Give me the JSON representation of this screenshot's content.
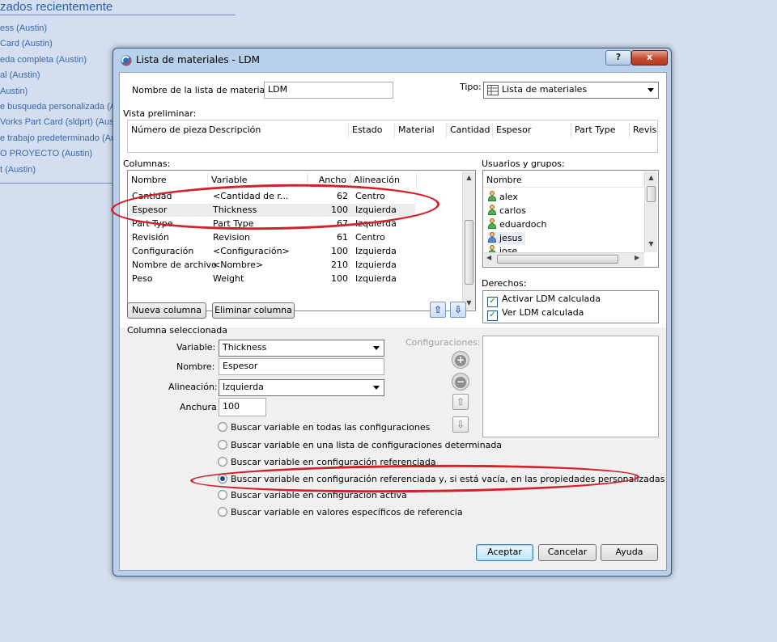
{
  "background": {
    "title": "zados recientemente",
    "items": [
      "ess (Austin)",
      "Card (Austin)",
      "eda completa (Austin)",
      "al (Austin)",
      "Austin)",
      "e busqueda personalizada (A",
      "Vorks Part Card  (sldprt) (Aus",
      "e trabajo predeterminado (Au",
      "O PROYECTO (Austin)",
      "t (Austin)"
    ]
  },
  "dialog": {
    "title": "Lista de materiales - LDM",
    "help_label": "?",
    "close_label": "x",
    "name_label": "Nombre de la lista de materiales:",
    "name_value": "LDM",
    "type_label": "Tipo:",
    "type_value": "Lista de materiales",
    "preview_label": "Vista preliminar:",
    "preview_columns": [
      "Número de pieza",
      "Descripción",
      "Estado",
      "Material",
      "Cantidad",
      "Espesor",
      "Part Type",
      "Revis"
    ],
    "columns_label": "Columnas:",
    "columns_headers": [
      "Nombre",
      "Variable",
      "Ancho",
      "Alineación"
    ],
    "columns_rows": [
      {
        "name": "Cantidad",
        "variable": "<Cantidad de r...",
        "width": "62",
        "align": "Centro"
      },
      {
        "name": "Espesor",
        "variable": "Thickness",
        "width": "100",
        "align": "Izquierda"
      },
      {
        "name": "Part Type",
        "variable": "Part Type",
        "width": "67",
        "align": "Izquierda"
      },
      {
        "name": "Revisión",
        "variable": "Revision",
        "width": "61",
        "align": "Centro"
      },
      {
        "name": "Configuración",
        "variable": "<Configuración>",
        "width": "100",
        "align": "Izquierda"
      },
      {
        "name": "Nombre de archivo",
        "variable": "<Nombre>",
        "width": "210",
        "align": "Izquierda"
      },
      {
        "name": "Peso",
        "variable": "Weight",
        "width": "100",
        "align": "Izquierda"
      }
    ],
    "users_label": "Usuarios y grupos:",
    "users_header": "Nombre",
    "users": [
      "alex",
      "carlos",
      "eduardoch",
      "jesus",
      "jose"
    ],
    "rights_label": "Derechos:",
    "rights": [
      "Activar LDM calculada",
      "Ver LDM calculada"
    ],
    "new_column": "Nueva columna",
    "delete_column": "Eliminar columna",
    "selected_column_label": "Columna seleccionada",
    "variable_label": "Variable:",
    "variable_value": "Thickness",
    "name_field_label": "Nombre:",
    "name_field_value": "Espesor",
    "alignment_label": "Alineación:",
    "alignment_value": "Izquierda",
    "width_label": "Anchura",
    "width_value": "100",
    "configurations_label": "Configuraciones:",
    "radio_options": [
      "Buscar variable en todas las configuraciones",
      "Buscar variable en una lista de configuraciones determinada",
      "Buscar variable en configuración referenciada",
      "Buscar variable en configuración referenciada y, si está vacía, en las propiedades personalizadas",
      "Buscar variable en configuración activa",
      "Buscar variable en valores específicos de referencia"
    ],
    "selected_radio": 3,
    "accept": "Aceptar",
    "cancel": "Cancelar",
    "help": "Ayuda"
  },
  "colors": {
    "annotation": "#d4202a",
    "background": "#d3dff0"
  }
}
